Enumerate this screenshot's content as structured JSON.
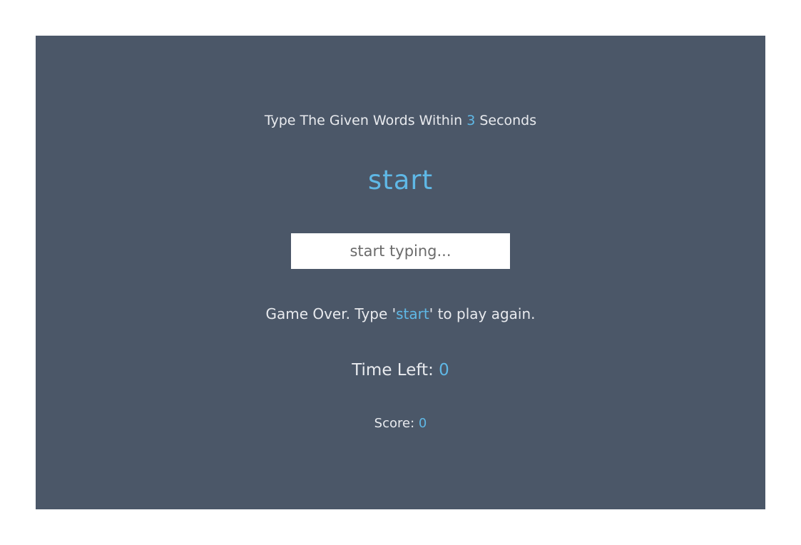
{
  "instruction": {
    "prefix": "Type The Given Words Within ",
    "seconds": "3",
    "suffix": " Seconds"
  },
  "current_word": "start",
  "input": {
    "placeholder": "start typing...",
    "value": ""
  },
  "message": {
    "prefix": "Game Over. Type '",
    "keyword": "start",
    "suffix": "' to play again."
  },
  "time_left": {
    "label": "Time Left: ",
    "value": "0"
  },
  "score": {
    "label": "Score: ",
    "value": "0"
  },
  "colors": {
    "panel_background": "#4b5768",
    "accent": "#5fb8e6",
    "text": "#e8eaee"
  }
}
